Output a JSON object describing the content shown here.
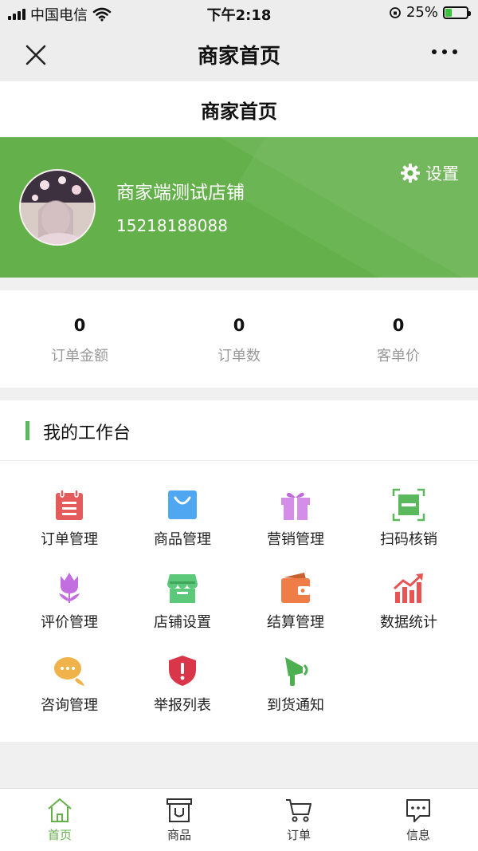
{
  "status_bar": {
    "carrier": "中国电信",
    "time": "下午2:18",
    "battery": "25%"
  },
  "nav": {
    "title": "商家首页"
  },
  "page": {
    "title": "商家首页"
  },
  "shop": {
    "name": "商家端测试店铺",
    "phone": "15218188088",
    "settings_label": "设置"
  },
  "stats": [
    {
      "value": "0",
      "label": "订单金额"
    },
    {
      "value": "0",
      "label": "订单数"
    },
    {
      "value": "0",
      "label": "客单价"
    }
  ],
  "workbench": {
    "title": "我的工作台",
    "accent_color": "#5cb85c",
    "items": [
      {
        "label": "订单管理",
        "icon": "clipboard-icon",
        "color": "#e55a5a"
      },
      {
        "label": "商品管理",
        "icon": "shopping-bag-icon",
        "color": "#4ea7f0"
      },
      {
        "label": "营销管理",
        "icon": "gift-icon",
        "color": "#d48ee8"
      },
      {
        "label": "扫码核销",
        "icon": "scan-icon",
        "color": "#5cb85c"
      },
      {
        "label": "评价管理",
        "icon": "tulip-icon",
        "color": "#c36ee0"
      },
      {
        "label": "店铺设置",
        "icon": "storefront-icon",
        "color": "#5cc87a"
      },
      {
        "label": "结算管理",
        "icon": "wallet-icon",
        "color": "#ee7d48"
      },
      {
        "label": "数据统计",
        "icon": "chart-icon",
        "color": "#e85454"
      },
      {
        "label": "咨询管理",
        "icon": "chat-bubbles-icon",
        "color": "#f0b24a"
      },
      {
        "label": "举报列表",
        "icon": "shield-alert-icon",
        "color": "#d9364a"
      },
      {
        "label": "到货通知",
        "icon": "megaphone-icon",
        "color": "#4caf50"
      }
    ]
  },
  "tabs": [
    {
      "label": "首页",
      "icon": "home-icon",
      "active": true
    },
    {
      "label": "商品",
      "icon": "box-icon",
      "active": false
    },
    {
      "label": "订单",
      "icon": "cart-icon",
      "active": false
    },
    {
      "label": "信息",
      "icon": "message-icon",
      "active": false
    }
  ],
  "colors": {
    "brand": "#64b14c",
    "active_tab": "#64b14c"
  }
}
